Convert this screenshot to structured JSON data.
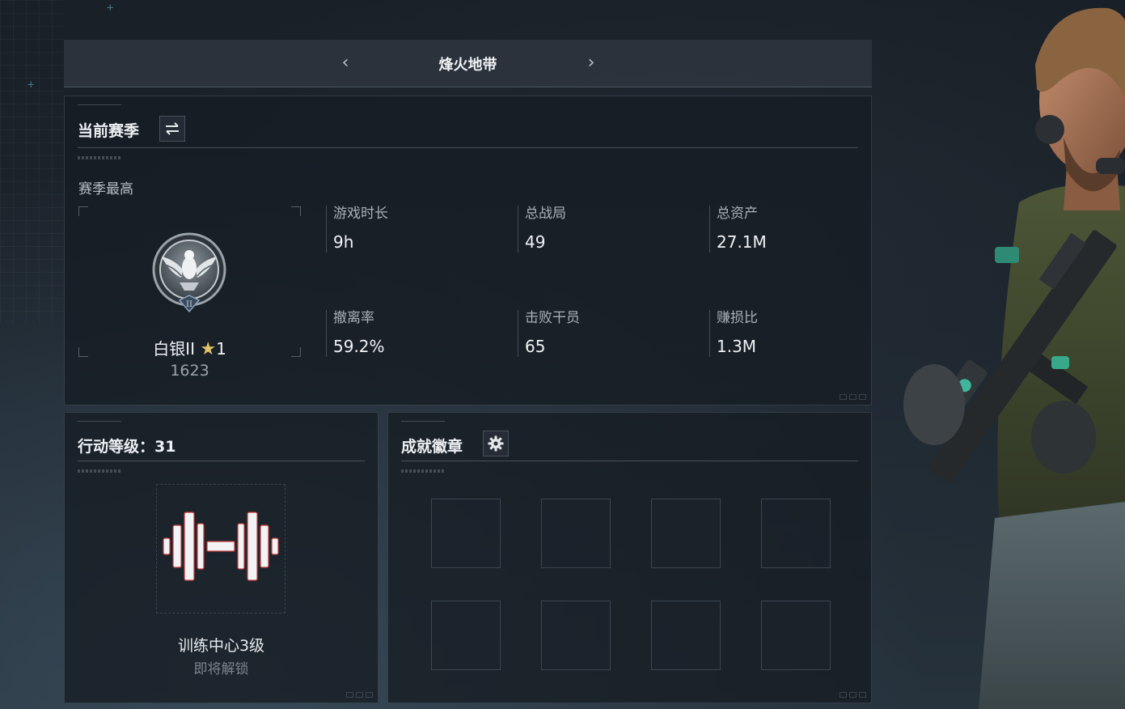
{
  "header": {
    "title": "烽火地带",
    "prev_icon": "chevron-left-icon",
    "next_icon": "chevron-right-icon"
  },
  "season": {
    "title": "当前赛季",
    "switch_icon": "swap-icon",
    "best_label": "赛季最高",
    "rank": {
      "name": "白银II",
      "stars": "1",
      "score": "1623",
      "emblem_numeral": "II"
    },
    "stats": [
      {
        "label": "游戏时长",
        "value": "9h"
      },
      {
        "label": "总战局",
        "value": "49"
      },
      {
        "label": "总资产",
        "value": "27.1M"
      },
      {
        "label": "撤离率",
        "value": "59.2%"
      },
      {
        "label": "击败干员",
        "value": "65"
      },
      {
        "label": "赚损比",
        "value": "1.3M"
      }
    ]
  },
  "level": {
    "title": "行动等级：31",
    "facility_name": "训练中心3级",
    "facility_status": "即将解锁",
    "icon": "dumbbell-icon"
  },
  "badges": {
    "title": "成就徽章",
    "settings_icon": "gear-icon",
    "slot_count": 8
  },
  "colors": {
    "panel_bg": "#161c22",
    "header_bg": "#2c343e",
    "text_primary": "#eef1f4",
    "text_secondary": "#a9b1b8",
    "star": "#e0c267"
  }
}
